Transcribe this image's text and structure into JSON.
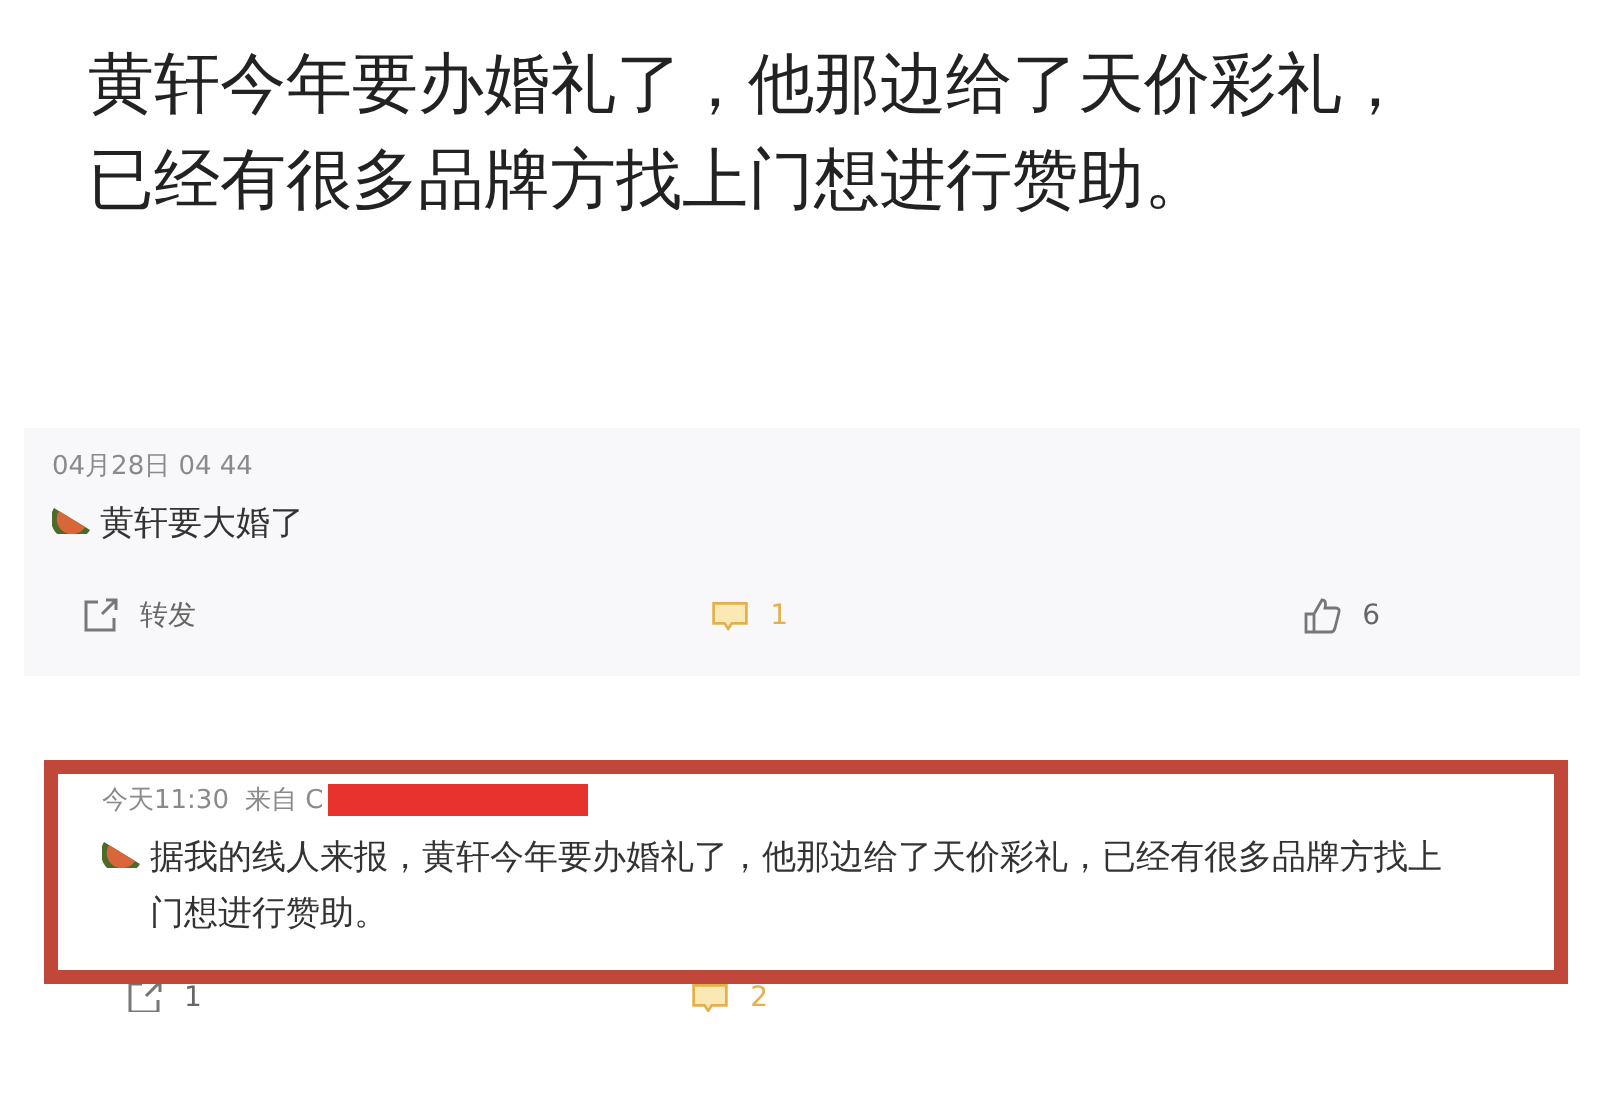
{
  "caption": "黄轩今年要办婚礼了，他那边给了天价彩礼，已经有很多品牌方找上门想进行赞助。",
  "posts": [
    {
      "time": "04月28日 04 44",
      "text": "黄轩要大婚了",
      "highlighted": false,
      "actions": [
        {
          "kind": "share",
          "label": "转发"
        },
        {
          "kind": "comment",
          "label": "1"
        },
        {
          "kind": "like",
          "label": "6"
        }
      ]
    },
    {
      "time": "今天11:30",
      "source": "来自 C",
      "redacted": true,
      "text": "据我的线人来报，黄轩今年要办婚礼了，他那边给了天价彩礼，已经有很多品牌方找上门想进行赞助。",
      "highlighted": true,
      "actions": [
        {
          "kind": "share",
          "label": "1"
        },
        {
          "kind": "comment",
          "label": "2"
        }
      ]
    }
  ]
}
